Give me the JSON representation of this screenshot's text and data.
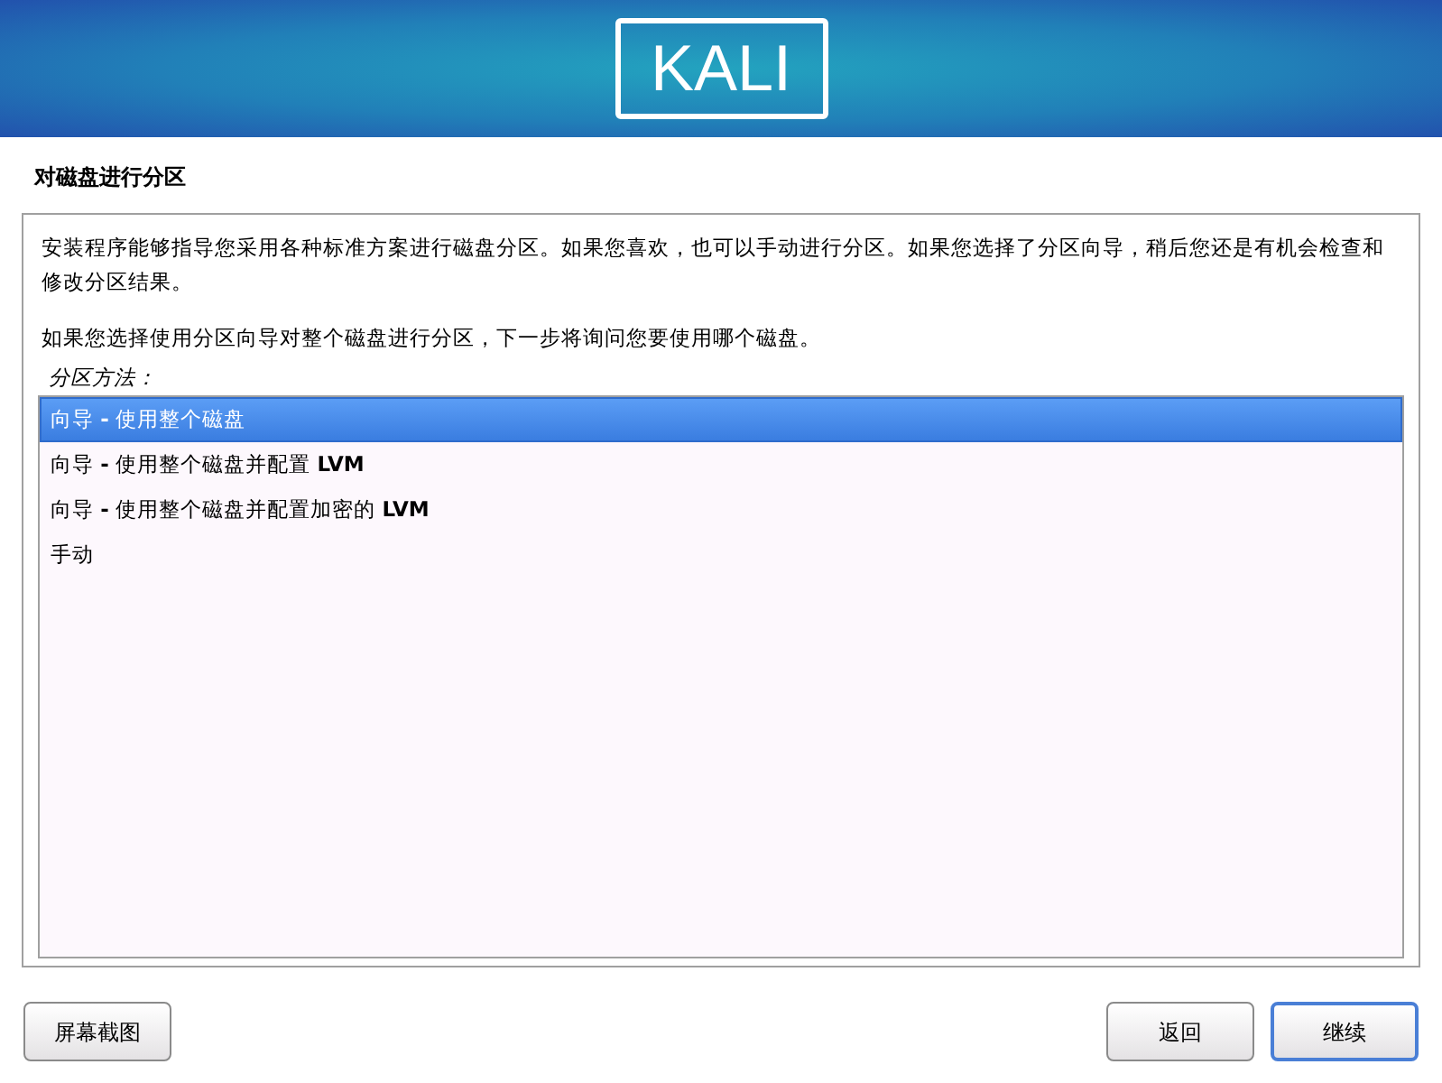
{
  "banner": {
    "logo": "KALI"
  },
  "title": "对磁盘进行分区",
  "paragraphs": [
    "安装程序能够指导您采用各种标准方案进行磁盘分区。如果您喜欢，也可以手动进行分区。如果您选择了分区向导，稍后您还是有机会检查和修改分区结果。",
    "如果您选择使用分区向导对整个磁盘进行分区，下一步将询问您要使用哪个磁盘。"
  ],
  "list_label": "分区方法：",
  "options": [
    {
      "label": "向导 **-** 使用整个磁盘",
      "selected": true
    },
    {
      "label": "向导 **-** 使用整个磁盘并配置 **LVM**",
      "selected": false
    },
    {
      "label": "向导 **-** 使用整个磁盘并配置加密的 **LVM**",
      "selected": false
    },
    {
      "label": "手动",
      "selected": false
    }
  ],
  "buttons": [
    {
      "label": "屏幕截图",
      "kind": "left",
      "focused": false
    },
    {
      "label": "返回",
      "kind": "right",
      "focused": false
    },
    {
      "label": "继续",
      "kind": "right",
      "focused": true
    }
  ]
}
